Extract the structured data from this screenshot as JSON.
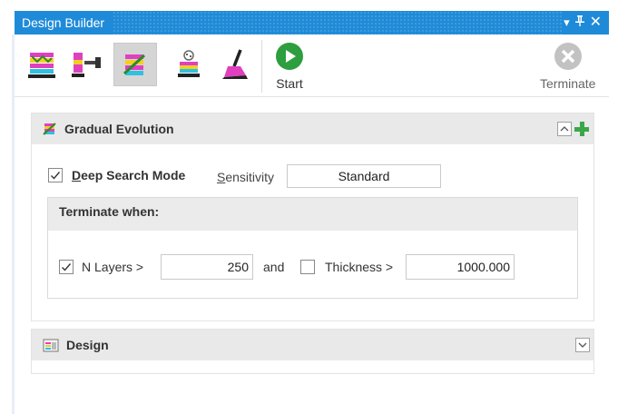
{
  "window": {
    "title": "Design Builder",
    "controls": {
      "menu": "▾",
      "pin": "ᵾ",
      "close": "✕"
    }
  },
  "toolbar": {
    "tools": [
      {
        "name": "layer-stack-tool",
        "icon": "layer-stack-icon",
        "active": false
      },
      {
        "name": "layer-insert-tool",
        "icon": "layer-insert-icon",
        "active": false
      },
      {
        "name": "gradual-evolution-tool",
        "icon": "gradual-evolution-icon",
        "active": true
      },
      {
        "name": "random-stack-tool",
        "icon": "random-stack-icon",
        "active": false
      },
      {
        "name": "cleanup-tool",
        "icon": "broom-icon",
        "active": false
      }
    ],
    "start_label": "Start",
    "terminate_label": "Terminate",
    "terminate_enabled": false
  },
  "gradual_panel": {
    "title": "Gradual Evolution",
    "collapse_glyph": "^",
    "deep_search": {
      "checked": true,
      "label_accel": "D",
      "label_rest": "eep Search Mode"
    },
    "sensitivity": {
      "label_accel": "S",
      "label_rest": "ensitivity",
      "value": "Standard"
    },
    "terminate_when": {
      "title": "Terminate when:",
      "n_layers": {
        "checked": true,
        "label": "N Layers >",
        "value": "250"
      },
      "joiner": "and",
      "thickness": {
        "checked": false,
        "label": "Thickness >",
        "value": "1000.000"
      }
    }
  },
  "design_panel": {
    "title": "Design",
    "expand_glyph": "v"
  },
  "colors": {
    "title_bar": "#1f8bd8",
    "start_green": "#2e9e3e",
    "terminate_gray": "#b9b9b9",
    "panel_header": "#e9e9e9",
    "active_tool": "#d5d5d5"
  }
}
